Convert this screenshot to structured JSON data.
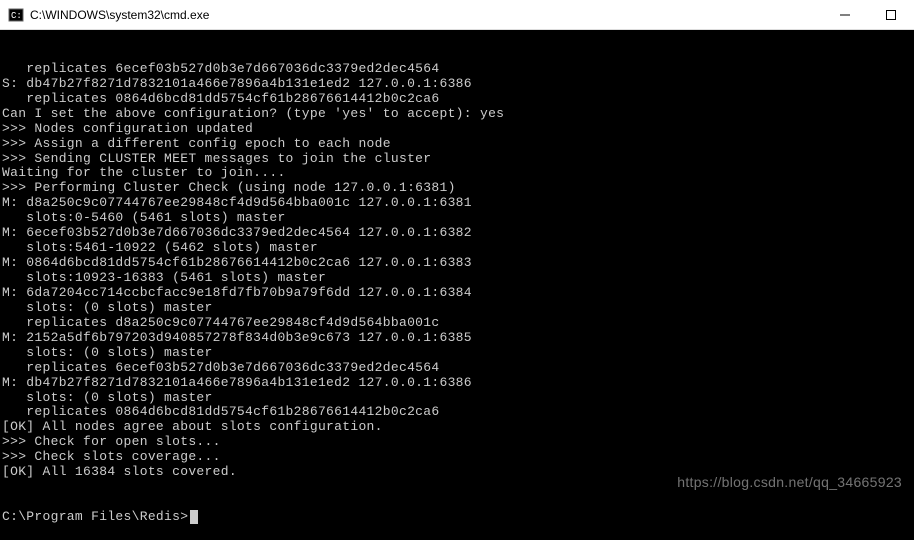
{
  "window": {
    "title": "C:\\WINDOWS\\system32\\cmd.exe"
  },
  "lines": [
    "   replicates 6ecef03b527d0b3e7d667036dc3379ed2dec4564",
    "S: db47b27f8271d7832101a466e7896a4b131e1ed2 127.0.0.1:6386",
    "   replicates 0864d6bcd81dd5754cf61b28676614412b0c2ca6",
    "Can I set the above configuration? (type 'yes' to accept): yes",
    ">>> Nodes configuration updated",
    ">>> Assign a different config epoch to each node",
    ">>> Sending CLUSTER MEET messages to join the cluster",
    "Waiting for the cluster to join....",
    ">>> Performing Cluster Check (using node 127.0.0.1:6381)",
    "M: d8a250c9c07744767ee29848cf4d9d564bba001c 127.0.0.1:6381",
    "   slots:0-5460 (5461 slots) master",
    "M: 6ecef03b527d0b3e7d667036dc3379ed2dec4564 127.0.0.1:6382",
    "   slots:5461-10922 (5462 slots) master",
    "M: 0864d6bcd81dd5754cf61b28676614412b0c2ca6 127.0.0.1:6383",
    "   slots:10923-16383 (5461 slots) master",
    "M: 6da7204cc714ccbcfacc9e18fd7fb70b9a79f6dd 127.0.0.1:6384",
    "   slots: (0 slots) master",
    "   replicates d8a250c9c07744767ee29848cf4d9d564bba001c",
    "M: 2152a5df6b797203d940857278f834d0b3e9c673 127.0.0.1:6385",
    "   slots: (0 slots) master",
    "   replicates 6ecef03b527d0b3e7d667036dc3379ed2dec4564",
    "M: db47b27f8271d7832101a466e7896a4b131e1ed2 127.0.0.1:6386",
    "   slots: (0 slots) master",
    "   replicates 0864d6bcd81dd5754cf61b28676614412b0c2ca6",
    "[OK] All nodes agree about slots configuration.",
    ">>> Check for open slots...",
    ">>> Check slots coverage...",
    "[OK] All 16384 slots covered.",
    ""
  ],
  "prompt": "C:\\Program Files\\Redis>",
  "watermark": "https://blog.csdn.net/qq_34665923"
}
